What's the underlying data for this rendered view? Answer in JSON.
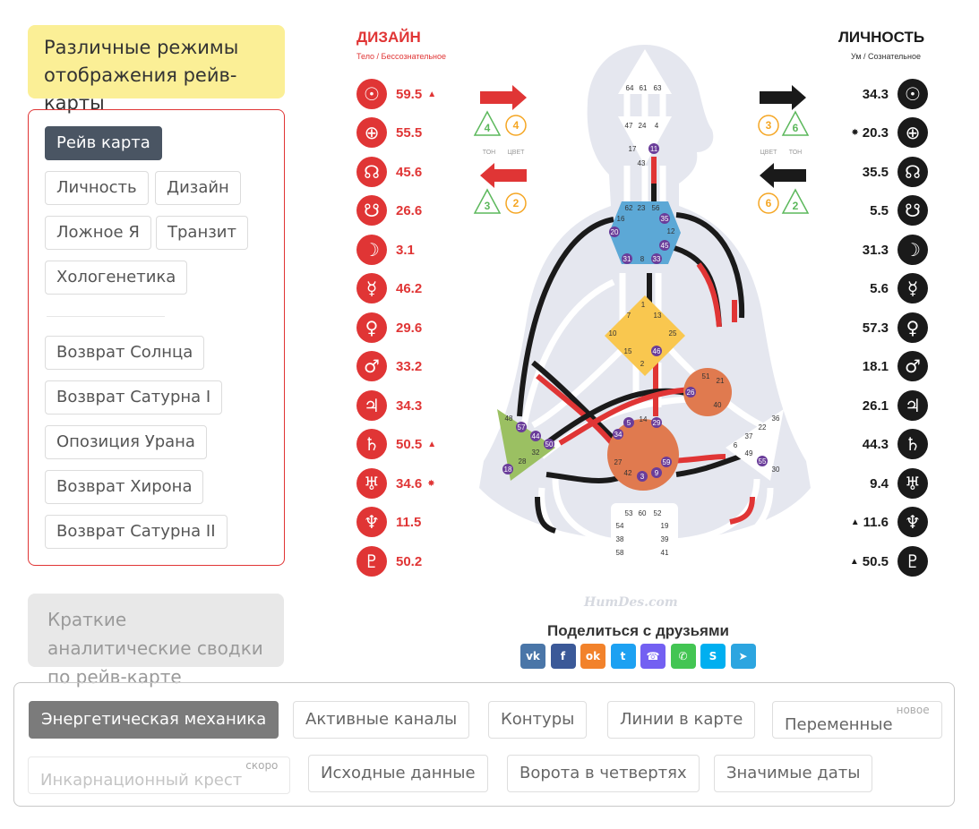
{
  "modes_title": "Различные режимы отображения рейв-карты",
  "mode_buttons": [
    "Рейв карта",
    "Личность",
    "Дизайн",
    "Ложное Я",
    "Транзит",
    "Хологенетика"
  ],
  "return_buttons": [
    "Возврат Солнца",
    "Возврат Сатурна I",
    "Опозиция Урана",
    "Возврат Хирона",
    "Возврат Сатурна II"
  ],
  "summary": "Краткие аналитические сводки по рейв-карте",
  "design": {
    "title": "ДИЗАЙН",
    "subtitle": "Тело / Бессознательное",
    "planets": [
      {
        "icon": "sun-icon",
        "glyph": "☉",
        "value": "59.5",
        "mark": "▲"
      },
      {
        "icon": "earth-icon",
        "glyph": "⊕",
        "value": "55.5",
        "mark": ""
      },
      {
        "icon": "north-node-icon",
        "glyph": "☊",
        "value": "45.6",
        "mark": ""
      },
      {
        "icon": "south-node-icon",
        "glyph": "☋",
        "value": "26.6",
        "mark": ""
      },
      {
        "icon": "moon-icon",
        "glyph": "☽",
        "value": "3.1",
        "mark": ""
      },
      {
        "icon": "mercury-icon",
        "glyph": "☿",
        "value": "46.2",
        "mark": ""
      },
      {
        "icon": "venus-icon",
        "glyph": "♀",
        "value": "29.6",
        "mark": ""
      },
      {
        "icon": "mars-icon",
        "glyph": "♂",
        "value": "33.2",
        "mark": ""
      },
      {
        "icon": "jupiter-icon",
        "glyph": "♃",
        "value": "34.3",
        "mark": ""
      },
      {
        "icon": "saturn-icon",
        "glyph": "♄",
        "value": "50.5",
        "mark": "▲"
      },
      {
        "icon": "uranus-icon",
        "glyph": "♅",
        "value": "34.6",
        "mark": "✸"
      },
      {
        "icon": "neptune-icon",
        "glyph": "♆",
        "value": "11.5",
        "mark": ""
      },
      {
        "icon": "pluto-icon",
        "glyph": "♇",
        "value": "50.2",
        "mark": ""
      }
    ],
    "arrows": {
      "top": {
        "tone": "4",
        "color": "4"
      },
      "bottom": {
        "tone": "3",
        "color": "2"
      }
    },
    "tone_label": "ТОН",
    "color_label": "ЦВЕТ"
  },
  "personality": {
    "title": "ЛИЧНОСТЬ",
    "subtitle": "Ум / Сознательное",
    "planets": [
      {
        "icon": "sun-icon",
        "glyph": "☉",
        "value": "34.3",
        "mark": ""
      },
      {
        "icon": "earth-icon",
        "glyph": "⊕",
        "value": "20.3",
        "mark": "✸"
      },
      {
        "icon": "north-node-icon",
        "glyph": "☊",
        "value": "35.5",
        "mark": ""
      },
      {
        "icon": "south-node-icon",
        "glyph": "☋",
        "value": "5.5",
        "mark": ""
      },
      {
        "icon": "moon-icon",
        "glyph": "☽",
        "value": "31.3",
        "mark": ""
      },
      {
        "icon": "mercury-icon",
        "glyph": "☿",
        "value": "5.6",
        "mark": ""
      },
      {
        "icon": "venus-icon",
        "glyph": "♀",
        "value": "57.3",
        "mark": ""
      },
      {
        "icon": "mars-icon",
        "glyph": "♂",
        "value": "18.1",
        "mark": ""
      },
      {
        "icon": "jupiter-icon",
        "glyph": "♃",
        "value": "26.1",
        "mark": ""
      },
      {
        "icon": "saturn-icon",
        "glyph": "♄",
        "value": "44.3",
        "mark": ""
      },
      {
        "icon": "uranus-icon",
        "glyph": "♅",
        "value": "9.4",
        "mark": ""
      },
      {
        "icon": "neptune-icon",
        "glyph": "♆",
        "value": "11.6",
        "mark": "▲"
      },
      {
        "icon": "pluto-icon",
        "glyph": "♇",
        "value": "50.5",
        "mark": "▲"
      }
    ],
    "arrows": {
      "top": {
        "color": "3",
        "tone": "6"
      },
      "bottom": {
        "color": "6",
        "tone": "2"
      }
    },
    "tone_label": "ТОН",
    "color_label": "ЦВЕТ"
  },
  "bodygraph": {
    "head": [
      "64",
      "61",
      "63"
    ],
    "ajna": [
      "47",
      "24",
      "4",
      "17",
      "11",
      "43"
    ],
    "throat": [
      "62",
      "23",
      "56",
      "16",
      "35",
      "20",
      "12",
      "45",
      "31",
      "8",
      "33"
    ],
    "g": [
      "1",
      "7",
      "13",
      "10",
      "25",
      "15",
      "46",
      "2"
    ],
    "ego": [
      "51",
      "21",
      "26",
      "40"
    ],
    "spleen": [
      "48",
      "57",
      "44",
      "50",
      "32",
      "28",
      "18"
    ],
    "sacral": [
      "14",
      "5",
      "29",
      "34",
      "27",
      "59",
      "42",
      "3",
      "9"
    ],
    "solar": [
      "36",
      "22",
      "37",
      "6",
      "49",
      "55",
      "30"
    ],
    "root": [
      "53",
      "60",
      "52",
      "54",
      "19",
      "38",
      "39",
      "58",
      "41"
    ],
    "watermark": "HumDes.com"
  },
  "share": {
    "title": "Поделиться с друзьями",
    "networks": [
      {
        "name": "vk",
        "label": "vk",
        "color": "#4a76a8"
      },
      {
        "name": "facebook",
        "label": "f",
        "color": "#3b5998"
      },
      {
        "name": "odnoklassniki",
        "label": "ok",
        "color": "#f2822b"
      },
      {
        "name": "twitter",
        "label": "t",
        "color": "#1da1f2"
      },
      {
        "name": "viber",
        "label": "☎",
        "color": "#7360f2"
      },
      {
        "name": "whatsapp",
        "label": "✆",
        "color": "#43c553"
      },
      {
        "name": "skype",
        "label": "S",
        "color": "#00aff0"
      },
      {
        "name": "telegram",
        "label": "➤",
        "color": "#2ca5e0"
      }
    ]
  },
  "tabs": [
    {
      "label": "Энергетическая механика",
      "state": "active"
    },
    {
      "label": "Активные каналы",
      "state": "normal"
    },
    {
      "label": "Контуры",
      "state": "normal"
    },
    {
      "label": "Линии в карте",
      "state": "normal"
    },
    {
      "label": "Переменные",
      "state": "normal",
      "badge": "новое"
    },
    {
      "label": "Инкарнационный крест",
      "state": "disabled",
      "badge": "скоро"
    },
    {
      "label": "Исходные данные",
      "state": "normal"
    },
    {
      "label": "Ворота в четвертях",
      "state": "normal"
    },
    {
      "label": "Значимые даты",
      "state": "normal"
    }
  ],
  "colors": {
    "red": "#e03535",
    "black": "#1a1a1a",
    "green": "#5cb85c",
    "orange": "#f5a623",
    "yellow_bg": "#fbef96"
  }
}
